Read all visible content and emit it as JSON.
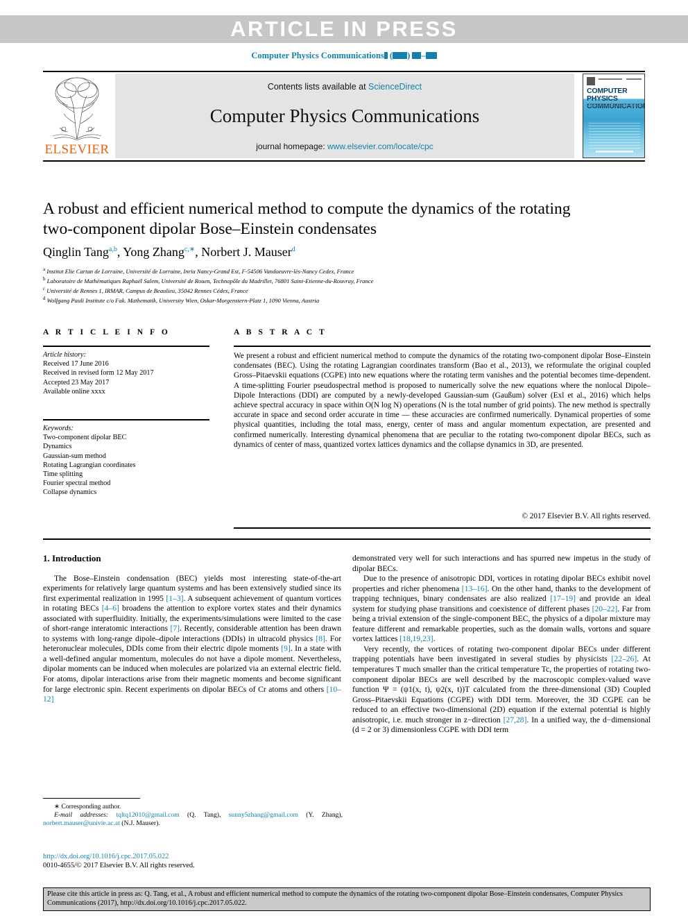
{
  "banner": {
    "article_in_press": "ARTICLE  IN  PRESS",
    "running_head": "Computer Physics Communications"
  },
  "journal_header": {
    "contents_prefix": "Contents lists available at",
    "sciencedirect": "ScienceDirect",
    "journal_title": "Computer Physics Communications",
    "homepage_label": "journal homepage:",
    "homepage_url": "www.elsevier.com/locate/cpc",
    "publisher_logo_text": "ELSEVIER",
    "cover_title": "COMPUTER PHYSICS COMMUNICATIONS"
  },
  "article": {
    "title": "A robust and efficient numerical method to compute the dynamics of the rotating two-component dipolar Bose–Einstein condensates",
    "authors": [
      {
        "name": "Qinglin Tang",
        "sup": "a,b"
      },
      {
        "name": "Yong Zhang",
        "sup": "c,∗"
      },
      {
        "name": "Norbert J. Mauser",
        "sup": "d"
      }
    ],
    "affiliations": [
      {
        "mark": "a",
        "text": "Institut Elie Cartan de Lorraine, Université de Lorraine, Inria Nancy-Grand Est, F-54506 Vandoeuvre-lès-Nancy Cedex, France"
      },
      {
        "mark": "b",
        "text": "Laboratoire de Mathématiques Raphaël Salem, Université de Rouen, Technopôle du Madrillet, 76801 Saint-Etienne-du-Rouvray, France"
      },
      {
        "mark": "c",
        "text": "Université de Rennes 1, IRMAR, Campus de Beaulieu, 35042 Rennes Cédex, France"
      },
      {
        "mark": "d",
        "text": "Wolfgang Pauli Institute c/o Fak. Mathematik, University Wien, Oskar-Morgenstern-Platz 1, 1090 Vienna, Austria"
      }
    ]
  },
  "article_info": {
    "heading": "A R T I C L E    I N F O",
    "history_label": "Article history:",
    "history": [
      "Received 17 June 2016",
      "Received in revised form 12 May 2017",
      "Accepted 23 May 2017",
      "Available online xxxx"
    ],
    "keywords_label": "Keywords:",
    "keywords": [
      "Two-component dipolar BEC",
      "Dynamics",
      "Gaussian-sum method",
      "Rotating Lagrangian coordinates",
      "Time splitting",
      "Fourier spectral method",
      "Collapse dynamics"
    ]
  },
  "abstract": {
    "heading": "A B S T R A C T",
    "text": "We present a robust and efficient numerical method to compute the dynamics of the rotating two-component dipolar Bose–Einstein condensates (BEC). Using the rotating Lagrangian coordinates transform (Bao et al., 2013), we reformulate the original coupled Gross–Pitaevskii equations (CGPE) into new equations where the rotating term vanishes and the potential becomes time-dependent. A time-splitting Fourier pseudospectral method is proposed to numerically solve the new equations where the nonlocal Dipole–Dipole Interactions (DDI) are computed by a newly-developed Gaussian-sum (Gaußum) solver (Exl et al., 2016) which helps achieve spectral accuracy in space within O(N log N) operations (N is the total number of grid points). The new method is spectrally accurate in space and second order accurate in time — these accuracies are confirmed numerically. Dynamical properties of some physical quantities, including the total mass, energy, center of mass and angular momentum expectation, are presented and confirmed numerically. Interesting dynamical phenomena that are peculiar to the rotating two-component dipolar BECs, such as dynamics of center of mass, quantized vortex lattices dynamics and the collapse dynamics in 3D, are presented.",
    "copyright": "© 2017 Elsevier B.V. All rights reserved."
  },
  "body": {
    "section_title": "1. Introduction",
    "left_paragraphs": [
      "The Bose–Einstein condensation (BEC) yields most interesting state-of-the-art experiments for relatively large quantum systems and has been extensively studied since its first experimental realization in 1995 [1–3]. A subsequent achievement of quantum vortices in rotating BECs [4–6] broadens the attention to explore vortex states and their dynamics associated with superfluidity. Initially, the experiments/simulations were limited to the case of short-range interatomic interactions [7]. Recently, considerable attention has been drawn to systems with long-range dipole–dipole interactions (DDIs) in ultracold physics [8]. For heteronuclear molecules, DDIs come from their electric dipole moments [9]. In a state with a well-defined angular momentum, molecules do not have a dipole moment. Nevertheless, dipolar moments can be induced when molecules are polarized via an external electric field. For atoms, dipolar interactions arise from their magnetic moments and become significant for large electronic spin. Recent experiments on dipolar BECs of Cr atoms and others [10–12]"
    ],
    "right_paragraphs": [
      "demonstrated very well for such interactions and has spurred new impetus in the study of dipolar BECs.",
      "Due to the presence of anisotropic DDI, vortices in rotating dipolar BECs exhibit novel properties and richer phenomena [13–16]. On the other hand, thanks to the development of trapping techniques, binary condensates are also realized [17–19] and provide an ideal system for studying phase transitions and coexistence of different phases [20–22]. Far from being a trivial extension of the single-component BEC, the physics of a dipolar mixture may feature different and remarkable properties, such as the domain walls, vortons and square vortex lattices [18,19,23].",
      "Very recently, the vortices of rotating two-component dipolar BECs under different trapping potentials have been investigated in several studies by physicists [22–26]. At temperatures T much smaller than the critical temperature Tc, the properties of rotating two-component dipolar BECs are well described by the macroscopic complex-valued wave function Ψ = (ψ1(x, t), ψ2(x, t))T calculated from the three-dimensional (3D) Coupled Gross–Pitaevskii Equations (CGPE) with DDI term. Moreover, the 3D CGPE can be reduced to an effective two-dimensional (2D) equation if the external potential is highly anisotropic, i.e. much stronger in z−direction [27,28]. In a unified way, the d−dimensional (d = 2 or 3) dimensionless CGPE with DDI term"
    ]
  },
  "footnote": {
    "corresponding_marker": "∗",
    "corresponding_label": "Corresponding author.",
    "email_label": "E-mail addresses:",
    "emails": [
      {
        "address": "tqltq12010@gmail.com",
        "owner": "(Q. Tang)"
      },
      {
        "address": "sunny5zhang@gmail.com",
        "owner": "(Y. Zhang)"
      },
      {
        "address": "norbert.mauser@univie.ac.at",
        "owner": "(N.J. Mauser)"
      }
    ],
    "doi_url": "http://dx.doi.org/10.1016/j.cpc.2017.05.022",
    "issn_line": "0010-4655/© 2017 Elsevier B.V. All rights reserved."
  },
  "citation_banner": {
    "text": "Please cite this article in press as: Q. Tang, et al., A robust and efficient numerical method to compute the dynamics of the rotating two-component dipolar Bose–Einstein condensates, Computer Physics Communications (2017), http://dx.doi.org/10.1016/j.cpc.2017.05.022."
  },
  "colors": {
    "accent": "#1481ac",
    "banner_grey": "#c6c6c6",
    "header_grey": "#e4e4e4",
    "elsevier_orange": "#e8620c"
  }
}
